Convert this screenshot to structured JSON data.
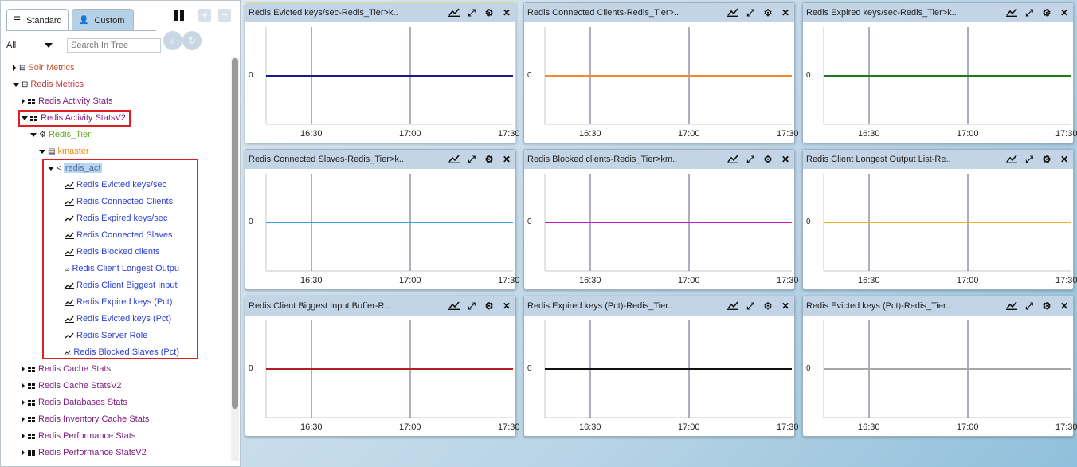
{
  "left": {
    "tabs": [
      {
        "label": "Standard"
      },
      {
        "label": "Custom"
      }
    ],
    "filter": {
      "selected": "All",
      "search_placeholder": "Search In Tree"
    },
    "tree": [
      {
        "label": "Solr Metrics"
      },
      {
        "label": "Redis Metrics"
      },
      {
        "label": "Redis Activity Stats"
      },
      {
        "label": "Redis Activity StatsV2"
      },
      {
        "label": "Redis_Tier"
      },
      {
        "label": "kmaster"
      },
      {
        "label": "redis_act"
      },
      {
        "label": "Redis Evicted keys/sec"
      },
      {
        "label": "Redis Connected Clients"
      },
      {
        "label": "Redis Expired keys/sec"
      },
      {
        "label": "Redis Connected Slaves"
      },
      {
        "label": "Redis Blocked clients"
      },
      {
        "label": "Redis Client Longest Outpu"
      },
      {
        "label": "Redis Client Biggest Input"
      },
      {
        "label": "Redis Expired keys (Pct)"
      },
      {
        "label": "Redis Evicted keys (Pct)"
      },
      {
        "label": "Redis Server Role"
      },
      {
        "label": "Redis Blocked Slaves (Pct)"
      },
      {
        "label": "Redis Cache Stats"
      },
      {
        "label": "Redis Cache StatsV2"
      },
      {
        "label": "Redis Databases Stats"
      },
      {
        "label": "Redis Inventory Cache Stats"
      },
      {
        "label": "Redis Performance Stats"
      },
      {
        "label": "Redis Performance StatsV2"
      }
    ]
  },
  "panels": [
    {
      "title": "Redis Evicted keys/sec-Redis_Tier>k..",
      "color": "#1a1a8c"
    },
    {
      "title": "Redis Connected Clients-Redis_Tier>..",
      "color": "#f08a30"
    },
    {
      "title": "Redis Expired keys/sec-Redis_Tier>k..",
      "color": "#1e7a1e"
    },
    {
      "title": "Redis Connected Slaves-Redis_Tier>k..",
      "color": "#3aa0e0"
    },
    {
      "title": "Redis Blocked clients-Redis_Tier>km..",
      "color": "#c21bc2"
    },
    {
      "title": "Redis Client Longest Output List-Re..",
      "color": "#f0b020"
    },
    {
      "title": "Redis Client Biggest Input Buffer-R..",
      "color": "#b02020"
    },
    {
      "title": "Redis Expired keys (Pct)-Redis_Tier..",
      "color": "#111111"
    },
    {
      "title": "Redis Evicted keys (Pct)-Redis_Tier..",
      "color": "#a8a8a8"
    }
  ],
  "chart": {
    "zero_label": "0",
    "x_ticks": [
      "16:30",
      "17:00",
      "17:30"
    ]
  }
}
